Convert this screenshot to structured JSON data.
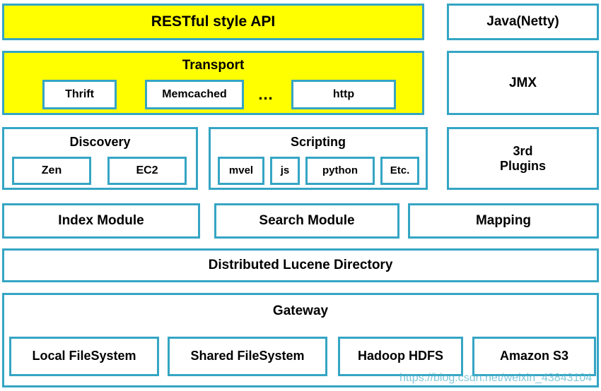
{
  "diagram": {
    "title": "Elasticsearch architecture layered diagram",
    "colors": {
      "border": "#35A5C4",
      "highlight_fill": "#FFFF00",
      "plain_fill": "#FFFFFF",
      "text": "#000000",
      "watermark": "#57B6CE"
    }
  },
  "layers": {
    "restful_api": {
      "label": "RESTful style API"
    },
    "transport": {
      "label": "Transport",
      "items": [
        {
          "label": "Thrift"
        },
        {
          "label": "Memcached"
        },
        {
          "label": "..."
        },
        {
          "label": "http"
        }
      ]
    },
    "discovery": {
      "label": "Discovery",
      "items": [
        {
          "label": "Zen"
        },
        {
          "label": "EC2"
        }
      ]
    },
    "scripting": {
      "label": "Scripting",
      "items": [
        {
          "label": "mvel"
        },
        {
          "label": "js"
        },
        {
          "label": "python"
        },
        {
          "label": "Etc."
        }
      ]
    },
    "modules": [
      {
        "label": "Index Module"
      },
      {
        "label": "Search Module"
      },
      {
        "label": "Mapping"
      }
    ],
    "lucene": {
      "label": "Distributed Lucene Directory"
    },
    "gateway": {
      "label": "Gateway",
      "items": [
        {
          "label": "Local FileSystem"
        },
        {
          "label": "Shared FileSystem"
        },
        {
          "label": "Hadoop HDFS"
        },
        {
          "label": "Amazon S3"
        }
      ]
    }
  },
  "sidebar": {
    "items": [
      {
        "label": "Java(Netty)"
      },
      {
        "label": "JMX"
      },
      {
        "label": "3rd\nPlugins"
      }
    ],
    "third_plugins_line1": "3rd",
    "third_plugins_line2": "Plugins"
  },
  "watermark": {
    "text": "https://blog.csdn.net/weixin_43843104"
  }
}
